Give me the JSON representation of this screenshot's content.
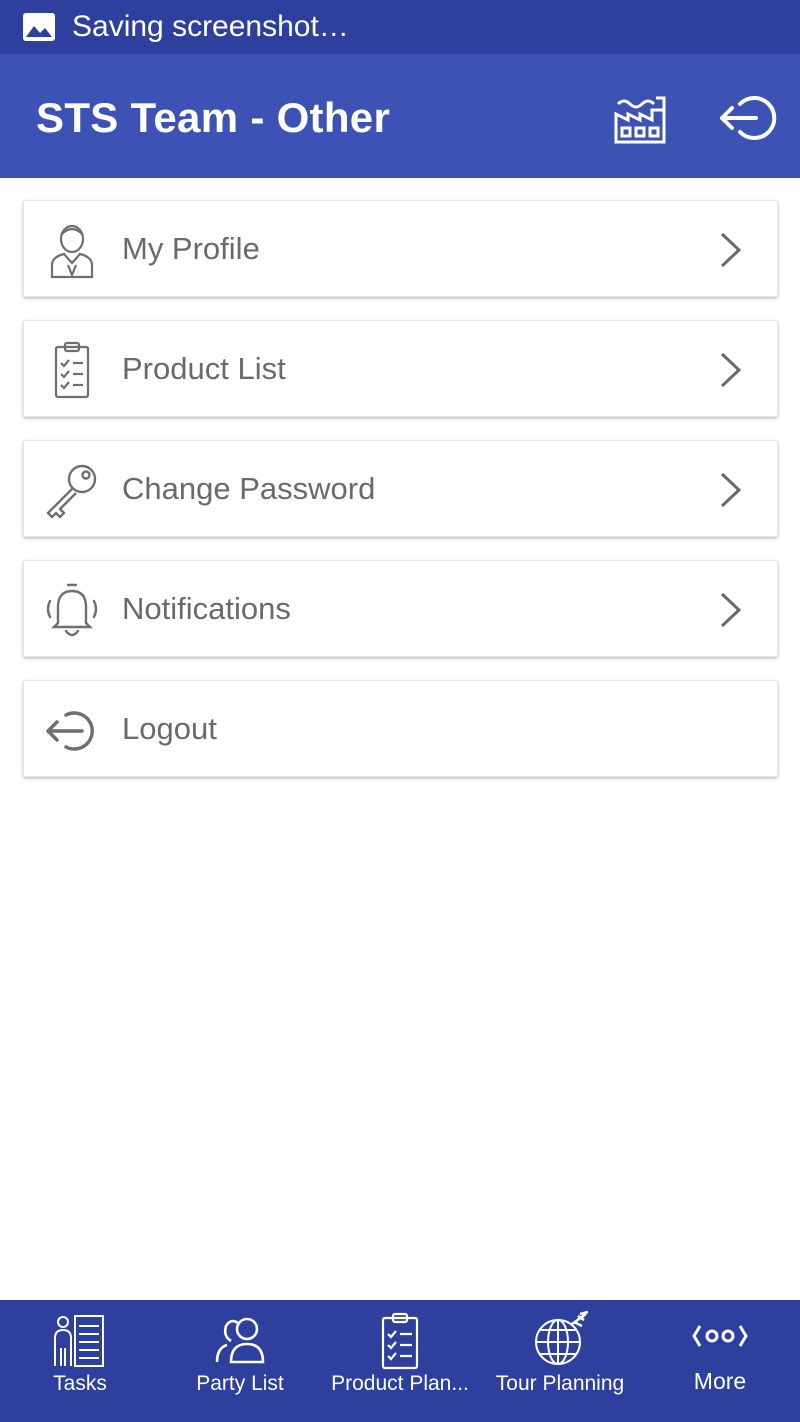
{
  "status_bar": {
    "text": "Saving screenshot…",
    "icon": "image-icon"
  },
  "app_bar": {
    "title": "STS Team - Other",
    "actions": [
      {
        "icon": "factory-icon"
      },
      {
        "icon": "logout-icon"
      }
    ]
  },
  "menu": {
    "items": [
      {
        "label": "My Profile",
        "icon": "user-profile-icon",
        "chevron": true
      },
      {
        "label": "Product List",
        "icon": "clipboard-checklist-icon",
        "chevron": true
      },
      {
        "label": "Change Password",
        "icon": "key-icon",
        "chevron": true
      },
      {
        "label": "Notifications",
        "icon": "bell-icon",
        "chevron": true
      },
      {
        "label": "Logout",
        "icon": "logout-icon",
        "chevron": false
      }
    ]
  },
  "bottom_nav": {
    "items": [
      {
        "label": "Tasks",
        "icon": "tasks-icon"
      },
      {
        "label": "Party List",
        "icon": "party-users-icon"
      },
      {
        "label": "Product Plan...",
        "icon": "product-clipboard-icon"
      },
      {
        "label": "Tour Planning",
        "icon": "globe-plane-icon"
      },
      {
        "label": "More",
        "icon": "more-dots-icon"
      }
    ]
  },
  "colors": {
    "status_bar": "#2e3f9e",
    "app_bar": "#3d52b5",
    "bottom_nav": "#2e3f9e",
    "menu_text": "#6a6a6a"
  }
}
